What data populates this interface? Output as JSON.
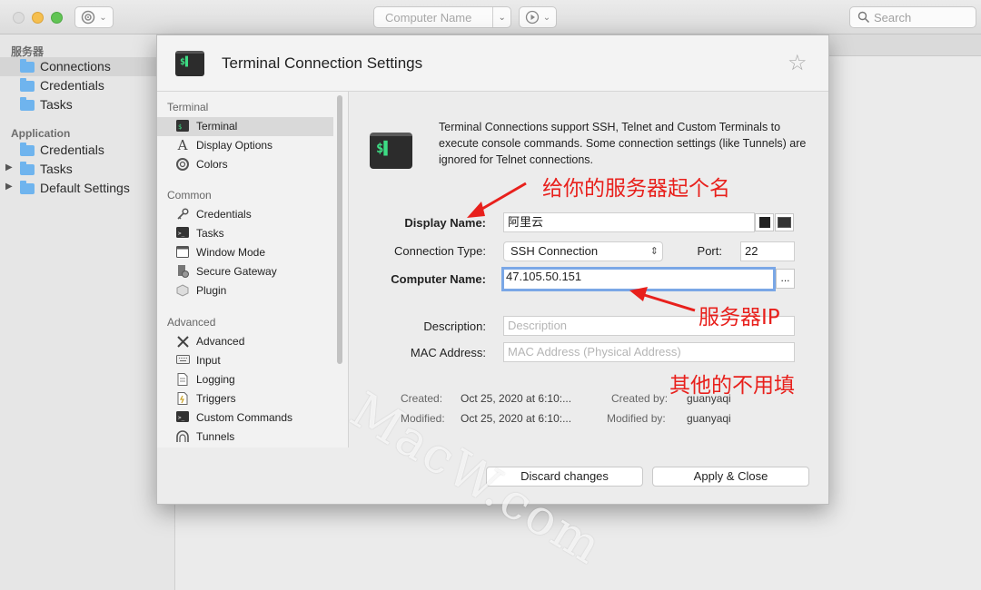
{
  "toolbar": {
    "computer_name_placeholder": "Computer Name",
    "search_placeholder": "Search"
  },
  "sidebar": {
    "section_server": "服务器",
    "section_application": "Application",
    "server_items": [
      {
        "label": "Connections",
        "selected": true
      },
      {
        "label": "Credentials"
      },
      {
        "label": "Tasks"
      }
    ],
    "app_items": [
      {
        "label": "Credentials"
      },
      {
        "label": "Tasks",
        "expandable": true
      },
      {
        "label": "Default Settings",
        "expandable": true
      }
    ]
  },
  "dialog": {
    "title": "Terminal Connection Settings",
    "icon_text": "$▌",
    "nav": {
      "sections": [
        "Terminal",
        "Common",
        "Advanced"
      ],
      "terminal_items": [
        "Terminal",
        "Display Options",
        "Colors"
      ],
      "common_items": [
        "Credentials",
        "Tasks",
        "Window Mode",
        "Secure Gateway",
        "Plugin"
      ],
      "advanced_items": [
        "Advanced",
        "Input",
        "Logging",
        "Triggers",
        "Custom Commands",
        "Tunnels"
      ]
    },
    "description": "Terminal Connections support SSH, Telnet and Custom Terminals to execute console commands. Some connection settings (like Tunnels) are ignored for Telnet connections.",
    "form": {
      "display_name_label": "Display Name:",
      "display_name_value": "阿里云",
      "connection_type_label": "Connection Type:",
      "connection_type_value": "SSH Connection",
      "port_label": "Port:",
      "port_value": "22",
      "computer_name_label": "Computer Name:",
      "computer_name_value": "47.105.50.151",
      "browse_label": "...",
      "description_label": "Description:",
      "description_placeholder": "Description",
      "mac_label": "MAC Address:",
      "mac_placeholder": "MAC Address (Physical Address)"
    },
    "meta": {
      "created_label": "Created:",
      "created_value": "Oct 25, 2020 at 6:10:...",
      "created_by_label": "Created by:",
      "created_by_value": "guanyaqi",
      "modified_label": "Modified:",
      "modified_value": "Oct 25, 2020 at 6:10:...",
      "modified_by_label": "Modified by:",
      "modified_by_value": "guanyaqi"
    },
    "buttons": {
      "discard": "Discard changes",
      "apply": "Apply & Close"
    }
  },
  "annotations": {
    "name_hint": "给你的服务器起个名",
    "ip_hint": "服务器IP",
    "other_hint": "其他的不用填",
    "color": "#e8201c"
  },
  "watermark": "MacW.com"
}
